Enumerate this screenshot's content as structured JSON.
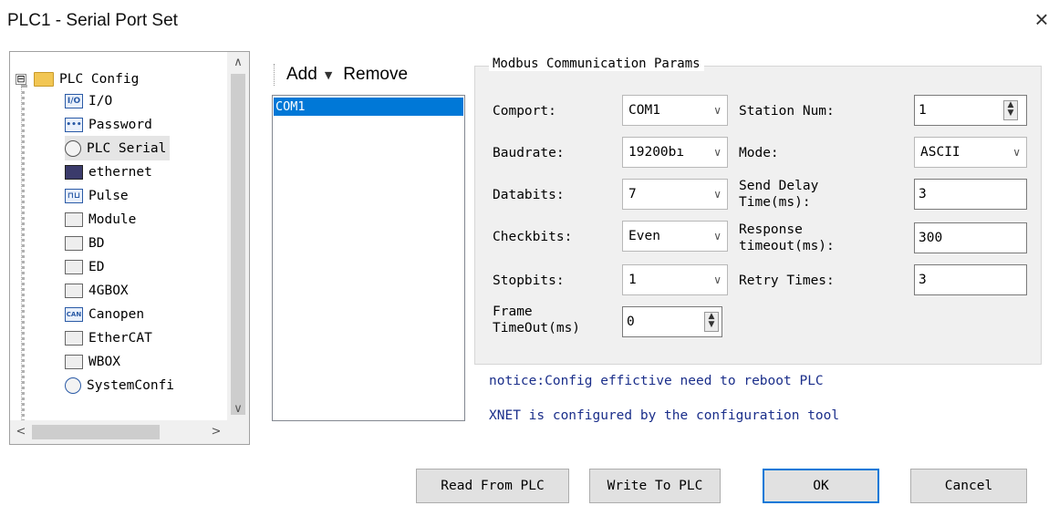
{
  "window": {
    "title": "PLC1 - Serial Port  Set",
    "close_glyph": "×"
  },
  "tree": {
    "root_label": "PLC Config",
    "root_expander": "⊟",
    "items": [
      {
        "label": "I/O",
        "icon": "io-icon"
      },
      {
        "label": "Password",
        "icon": "password-icon"
      },
      {
        "label": "PLC Serial",
        "icon": "serial-port-icon"
      },
      {
        "label": "ethernet",
        "icon": "ethernet-icon"
      },
      {
        "label": "Pulse",
        "icon": "pulse-icon"
      },
      {
        "label": "Module",
        "icon": "module-icon"
      },
      {
        "label": "BD",
        "icon": "bd-icon"
      },
      {
        "label": "ED",
        "icon": "ed-icon"
      },
      {
        "label": "4GBOX",
        "icon": "4gbox-icon"
      },
      {
        "label": "Canopen",
        "icon": "canopen-icon"
      },
      {
        "label": "EtherCAT",
        "icon": "ethercat-icon"
      },
      {
        "label": "WBOX",
        "icon": "wbox-icon"
      },
      {
        "label": "SystemConfi",
        "icon": "system-config-icon"
      }
    ],
    "selected_index": 2,
    "scroll_up": "∧",
    "scroll_down": "∨",
    "scroll_left": "<",
    "scroll_right": ">"
  },
  "toolbar": {
    "add_label": "Add",
    "add_arrow": "▼",
    "remove_label": "Remove"
  },
  "com_list": {
    "items": [
      "COM1"
    ],
    "selected": "COM1"
  },
  "params": {
    "group_title": "Modbus Communication Params",
    "comport": {
      "label": "Comport:",
      "value": "COM1"
    },
    "baudrate": {
      "label": "Baudrate:",
      "value": "19200bı"
    },
    "databits": {
      "label": "Databits:",
      "value": "7"
    },
    "checkbits": {
      "label": "Checkbits:",
      "value": "Even"
    },
    "stopbits": {
      "label": "Stopbits:",
      "value": "1"
    },
    "frame_timeout": {
      "label_line1": "Frame",
      "label_line2": "TimeOut(ms)",
      "value": "0"
    },
    "station_num": {
      "label": "Station Num:",
      "value": "1"
    },
    "mode": {
      "label": "Mode:",
      "value": "ASCII"
    },
    "send_delay": {
      "label_line1": "Send Delay",
      "label_line2": "Time(ms):",
      "value": "3"
    },
    "response_timeout": {
      "label_line1": "Response",
      "label_line2": "timeout(ms):",
      "value": "300"
    },
    "retry_times": {
      "label": "Retry Times:",
      "value": "3"
    },
    "dropdown_arrow": "∨",
    "spin_up": "▲",
    "spin_down": "▼"
  },
  "notices": {
    "line1": "notice:Config effictive need to reboot PLC",
    "line2": "XNET is configured by the configuration tool"
  },
  "buttons": {
    "read": "Read From PLC",
    "write": "Write To PLC",
    "ok": "OK",
    "cancel": "Cancel"
  },
  "colors": {
    "selection": "#0078d7",
    "notice_text": "#1a2e8a"
  }
}
